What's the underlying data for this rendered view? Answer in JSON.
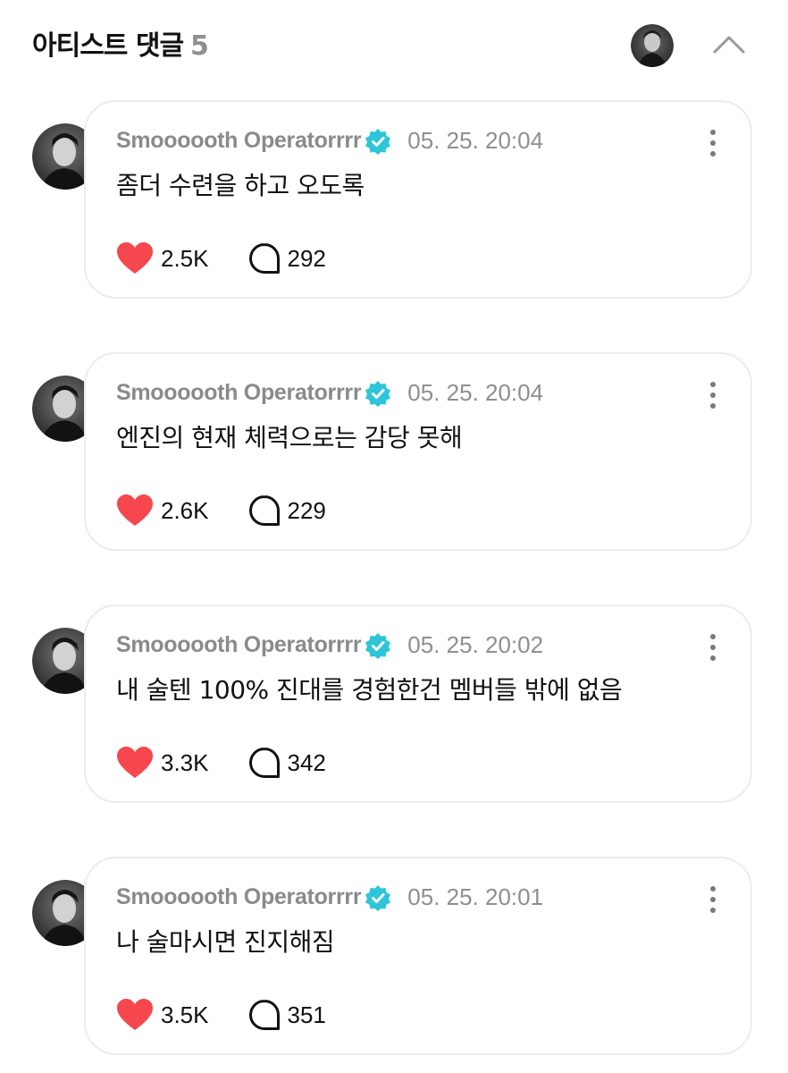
{
  "header": {
    "title": "아티스트 댓글",
    "count": "5"
  },
  "comments": [
    {
      "author": "Smoooooth Operatorrrr",
      "time": "05. 25. 20:04",
      "text": "좀더 수련을 하고 오도록",
      "likes": "2.5K",
      "replies": "292"
    },
    {
      "author": "Smoooooth Operatorrrr",
      "time": "05. 25. 20:04",
      "text": "엔진의 현재 체력으로는 감당 못해",
      "likes": "2.6K",
      "replies": "229"
    },
    {
      "author": "Smoooooth Operatorrrr",
      "time": "05. 25. 20:02",
      "text": "내 술텐 100% 진대를 경험한건 멤버들 밖에 없음",
      "likes": "3.3K",
      "replies": "342"
    },
    {
      "author": "Smoooooth Operatorrrr",
      "time": "05. 25. 20:01",
      "text": "나 술마시면 진지해짐",
      "likes": "3.5K",
      "replies": "351"
    }
  ],
  "icons": {
    "verified": "verified-badge-icon",
    "more": "more-vertical-icon",
    "like": "heart-icon",
    "reply": "speech-bubble-icon",
    "collapse": "chevron-up-icon"
  },
  "colors": {
    "heart": "#f5474d",
    "verified": "#2ec5d9",
    "muted_text": "#8a8a8a",
    "card_border": "#ececec"
  }
}
